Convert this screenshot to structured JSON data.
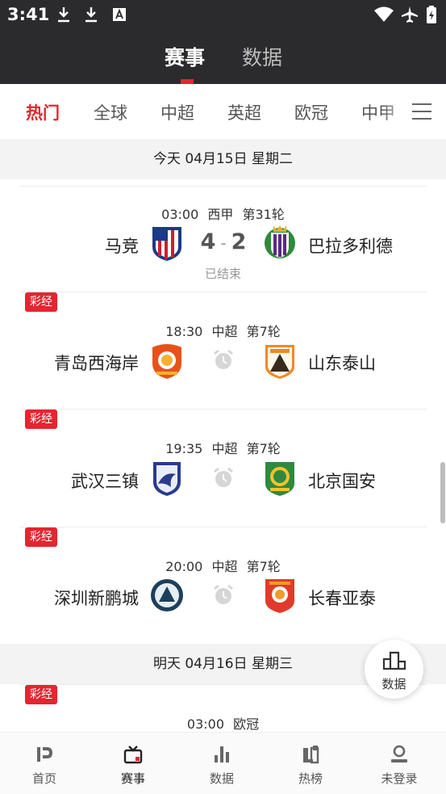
{
  "status_bar": {
    "time": "3:41"
  },
  "header": {
    "tabs": [
      {
        "label": "赛事",
        "active": true
      },
      {
        "label": "数据",
        "active": false
      }
    ]
  },
  "categories": {
    "items": [
      "热门",
      "全球",
      "中超",
      "英超",
      "欧冠",
      "中甲"
    ],
    "active_index": 0
  },
  "days": [
    {
      "header": "今天 04月15日 星期二"
    },
    {
      "header": "明天 04月16日 星期三"
    }
  ],
  "matches": [
    {
      "time": "03:00",
      "league": "西甲",
      "round": "第31轮",
      "home": "马竞",
      "away": "巴拉多利德",
      "home_score": "4",
      "away_score": "2",
      "separator": "-",
      "status": "已结束",
      "badge": ""
    },
    {
      "time": "18:30",
      "league": "中超",
      "round": "第7轮",
      "home": "青岛西海岸",
      "away": "山东泰山",
      "badge": "彩经"
    },
    {
      "time": "19:35",
      "league": "中超",
      "round": "第7轮",
      "home": "武汉三镇",
      "away": "北京国安",
      "badge": "彩经"
    },
    {
      "time": "20:00",
      "league": "中超",
      "round": "第7轮",
      "home": "深圳新鹏城",
      "away": "长春亚泰",
      "badge": "彩经"
    },
    {
      "time": "03:00",
      "league": "欧冠",
      "badge": "彩经"
    }
  ],
  "fab": {
    "label": "数据"
  },
  "bottom_nav": [
    {
      "label": "首页",
      "icon": "home-logo-icon"
    },
    {
      "label": "赛事",
      "icon": "tv-icon",
      "active": true
    },
    {
      "label": "数据",
      "icon": "bar-chart-icon"
    },
    {
      "label": "热榜",
      "icon": "hot-list-icon"
    },
    {
      "label": "未登录",
      "icon": "user-icon"
    }
  ],
  "colors": {
    "accent": "#e3262f",
    "header_bg": "#2b2b2d",
    "day_bg": "#f3f3f4"
  }
}
